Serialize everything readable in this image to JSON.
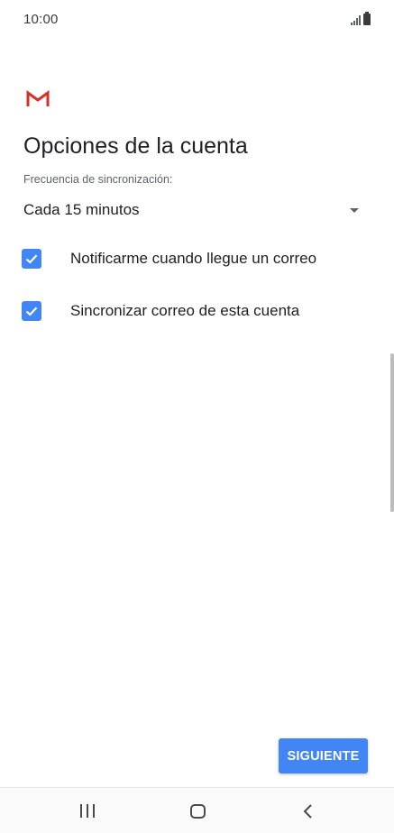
{
  "status_bar": {
    "time": "10:00",
    "signal_icon": "signal-icon",
    "battery_icon": "battery-icon"
  },
  "header": {
    "logo_icon": "gmail-logo-icon",
    "title": "Opciones de la cuenta"
  },
  "sync": {
    "label": "Frecuencia de sincronización:",
    "selected_value": "Cada 15 minutos",
    "dropdown_icon": "dropdown-arrow-icon"
  },
  "options": [
    {
      "label": "Notificarme cuando llegue un correo",
      "checked": true
    },
    {
      "label": "Sincronizar correo de esta cuenta",
      "checked": true
    }
  ],
  "actions": {
    "next_label": "SIGUIENTE"
  },
  "nav_bar": {
    "recent_icon": "recent-apps-icon",
    "home_icon": "home-icon",
    "back_icon": "back-icon"
  },
  "colors": {
    "accent": "#4285f4",
    "gmail_red": "#d93025"
  }
}
